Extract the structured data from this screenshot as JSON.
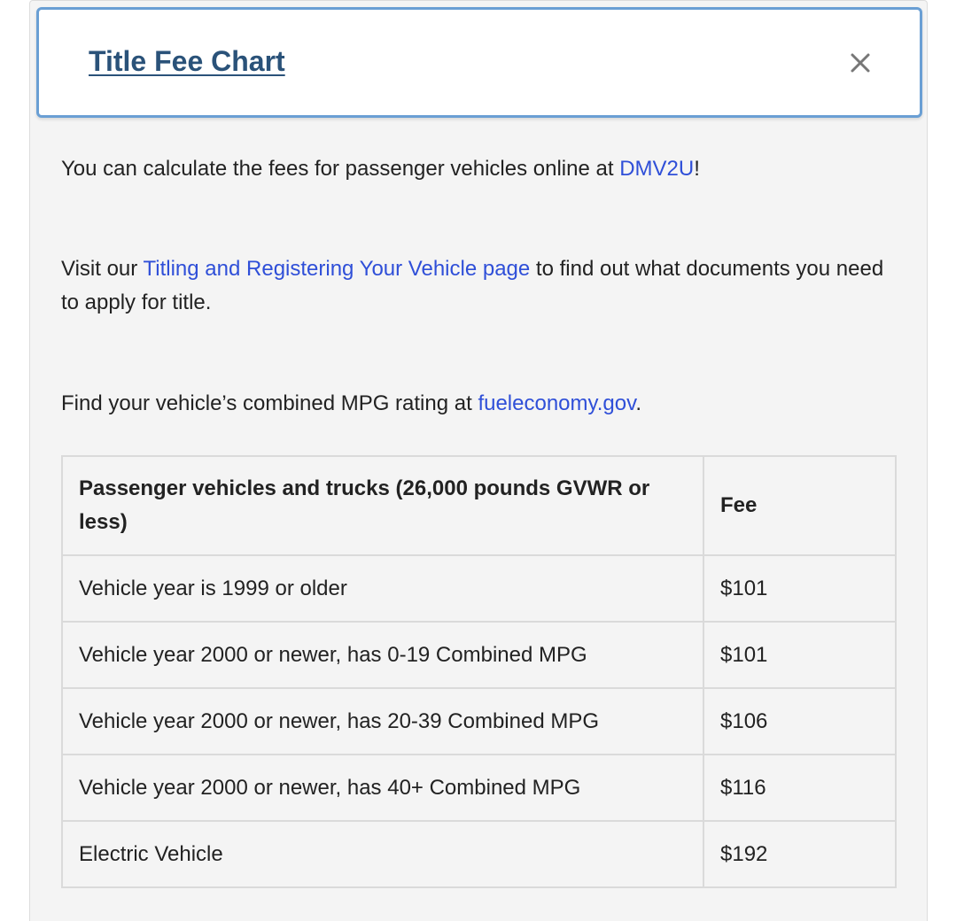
{
  "modal": {
    "title": "Title Fee Chart",
    "close_icon": "close-icon"
  },
  "intro": {
    "p1_before": "You can calculate the fees for passenger vehicles online at ",
    "p1_link": "DMV2U",
    "p1_after": "!",
    "p2_before": "Visit our ",
    "p2_link": "Titling and Registering Your Vehicle page",
    "p2_after": " to find out what documents you need to apply for title.",
    "p3_before": "Find your vehicle’s combined MPG rating at ",
    "p3_link": "fueleconomy.gov",
    "p3_after": "."
  },
  "table": {
    "headers": [
      "Passenger vehicles and trucks (26,000 pounds GVWR or less)",
      "Fee"
    ],
    "rows": [
      [
        "Vehicle year is 1999 or older",
        "$101"
      ],
      [
        "Vehicle year 2000 or newer, has 0-19 Combined MPG",
        "$101"
      ],
      [
        "Vehicle year 2000 or newer, has 20-39 Combined MPG",
        "$106"
      ],
      [
        "Vehicle year 2000 or newer, has 40+ Combined MPG",
        "$116"
      ],
      [
        "Electric Vehicle",
        "$192"
      ]
    ]
  },
  "colors": {
    "title": "#2a5279",
    "link": "#2f4fd8",
    "header_border": "#6a9fd4",
    "panel_bg": "#f4f4f4"
  }
}
